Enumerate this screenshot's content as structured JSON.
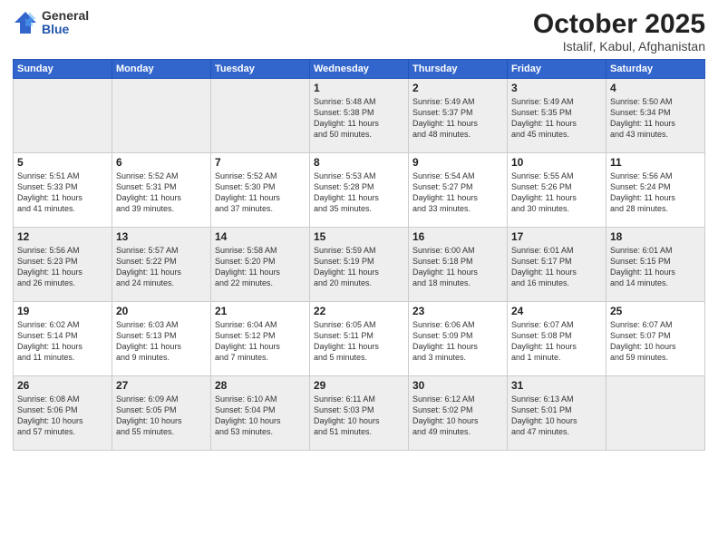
{
  "logo": {
    "general": "General",
    "blue": "Blue"
  },
  "header": {
    "month": "October 2025",
    "location": "Istalif, Kabul, Afghanistan"
  },
  "weekdays": [
    "Sunday",
    "Monday",
    "Tuesday",
    "Wednesday",
    "Thursday",
    "Friday",
    "Saturday"
  ],
  "weeks": [
    [
      {
        "day": "",
        "info": ""
      },
      {
        "day": "",
        "info": ""
      },
      {
        "day": "",
        "info": ""
      },
      {
        "day": "1",
        "info": "Sunrise: 5:48 AM\nSunset: 5:38 PM\nDaylight: 11 hours\nand 50 minutes."
      },
      {
        "day": "2",
        "info": "Sunrise: 5:49 AM\nSunset: 5:37 PM\nDaylight: 11 hours\nand 48 minutes."
      },
      {
        "day": "3",
        "info": "Sunrise: 5:49 AM\nSunset: 5:35 PM\nDaylight: 11 hours\nand 45 minutes."
      },
      {
        "day": "4",
        "info": "Sunrise: 5:50 AM\nSunset: 5:34 PM\nDaylight: 11 hours\nand 43 minutes."
      }
    ],
    [
      {
        "day": "5",
        "info": "Sunrise: 5:51 AM\nSunset: 5:33 PM\nDaylight: 11 hours\nand 41 minutes."
      },
      {
        "day": "6",
        "info": "Sunrise: 5:52 AM\nSunset: 5:31 PM\nDaylight: 11 hours\nand 39 minutes."
      },
      {
        "day": "7",
        "info": "Sunrise: 5:52 AM\nSunset: 5:30 PM\nDaylight: 11 hours\nand 37 minutes."
      },
      {
        "day": "8",
        "info": "Sunrise: 5:53 AM\nSunset: 5:28 PM\nDaylight: 11 hours\nand 35 minutes."
      },
      {
        "day": "9",
        "info": "Sunrise: 5:54 AM\nSunset: 5:27 PM\nDaylight: 11 hours\nand 33 minutes."
      },
      {
        "day": "10",
        "info": "Sunrise: 5:55 AM\nSunset: 5:26 PM\nDaylight: 11 hours\nand 30 minutes."
      },
      {
        "day": "11",
        "info": "Sunrise: 5:56 AM\nSunset: 5:24 PM\nDaylight: 11 hours\nand 28 minutes."
      }
    ],
    [
      {
        "day": "12",
        "info": "Sunrise: 5:56 AM\nSunset: 5:23 PM\nDaylight: 11 hours\nand 26 minutes."
      },
      {
        "day": "13",
        "info": "Sunrise: 5:57 AM\nSunset: 5:22 PM\nDaylight: 11 hours\nand 24 minutes."
      },
      {
        "day": "14",
        "info": "Sunrise: 5:58 AM\nSunset: 5:20 PM\nDaylight: 11 hours\nand 22 minutes."
      },
      {
        "day": "15",
        "info": "Sunrise: 5:59 AM\nSunset: 5:19 PM\nDaylight: 11 hours\nand 20 minutes."
      },
      {
        "day": "16",
        "info": "Sunrise: 6:00 AM\nSunset: 5:18 PM\nDaylight: 11 hours\nand 18 minutes."
      },
      {
        "day": "17",
        "info": "Sunrise: 6:01 AM\nSunset: 5:17 PM\nDaylight: 11 hours\nand 16 minutes."
      },
      {
        "day": "18",
        "info": "Sunrise: 6:01 AM\nSunset: 5:15 PM\nDaylight: 11 hours\nand 14 minutes."
      }
    ],
    [
      {
        "day": "19",
        "info": "Sunrise: 6:02 AM\nSunset: 5:14 PM\nDaylight: 11 hours\nand 11 minutes."
      },
      {
        "day": "20",
        "info": "Sunrise: 6:03 AM\nSunset: 5:13 PM\nDaylight: 11 hours\nand 9 minutes."
      },
      {
        "day": "21",
        "info": "Sunrise: 6:04 AM\nSunset: 5:12 PM\nDaylight: 11 hours\nand 7 minutes."
      },
      {
        "day": "22",
        "info": "Sunrise: 6:05 AM\nSunset: 5:11 PM\nDaylight: 11 hours\nand 5 minutes."
      },
      {
        "day": "23",
        "info": "Sunrise: 6:06 AM\nSunset: 5:09 PM\nDaylight: 11 hours\nand 3 minutes."
      },
      {
        "day": "24",
        "info": "Sunrise: 6:07 AM\nSunset: 5:08 PM\nDaylight: 11 hours\nand 1 minute."
      },
      {
        "day": "25",
        "info": "Sunrise: 6:07 AM\nSunset: 5:07 PM\nDaylight: 10 hours\nand 59 minutes."
      }
    ],
    [
      {
        "day": "26",
        "info": "Sunrise: 6:08 AM\nSunset: 5:06 PM\nDaylight: 10 hours\nand 57 minutes."
      },
      {
        "day": "27",
        "info": "Sunrise: 6:09 AM\nSunset: 5:05 PM\nDaylight: 10 hours\nand 55 minutes."
      },
      {
        "day": "28",
        "info": "Sunrise: 6:10 AM\nSunset: 5:04 PM\nDaylight: 10 hours\nand 53 minutes."
      },
      {
        "day": "29",
        "info": "Sunrise: 6:11 AM\nSunset: 5:03 PM\nDaylight: 10 hours\nand 51 minutes."
      },
      {
        "day": "30",
        "info": "Sunrise: 6:12 AM\nSunset: 5:02 PM\nDaylight: 10 hours\nand 49 minutes."
      },
      {
        "day": "31",
        "info": "Sunrise: 6:13 AM\nSunset: 5:01 PM\nDaylight: 10 hours\nand 47 minutes."
      },
      {
        "day": "",
        "info": ""
      }
    ]
  ],
  "shaded_weeks": [
    0,
    2,
    4
  ]
}
